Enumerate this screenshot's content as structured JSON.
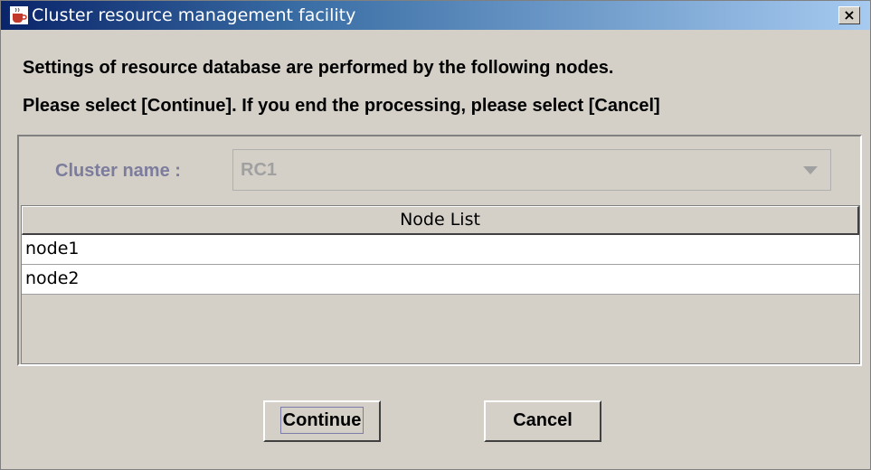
{
  "window": {
    "title": "Cluster resource management facility",
    "close_glyph": "×",
    "app_icon": "coffee-cup-icon"
  },
  "message": {
    "line1": "Settings of resource database are performed by the following nodes.",
    "line2": "Please select [Continue]. If you end the processing, please select [Cancel]"
  },
  "cluster": {
    "label": "Cluster name :",
    "selected": "RC1"
  },
  "node_table": {
    "header": "Node List",
    "rows": [
      "node1",
      "node2"
    ]
  },
  "buttons": {
    "continue_label": "Continue",
    "cancel_label": "Cancel"
  },
  "colors": {
    "title_gradient_start": "#0a246a",
    "title_gradient_end": "#a6caf0",
    "dialog_bg": "#d4d0c8",
    "disabled_label": "#7c7c9c"
  }
}
